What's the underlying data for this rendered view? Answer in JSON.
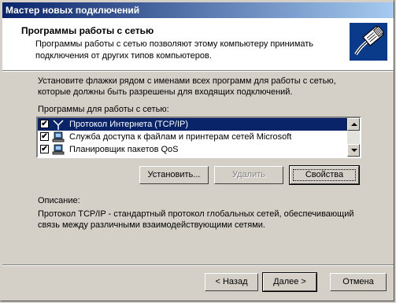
{
  "window": {
    "title": "Мастер новых подключений"
  },
  "header": {
    "title": "Программы работы с сетью",
    "description": "Программы работы с сетью позволяют этому компьютеру принимать подключения от других типов компьютеров.",
    "icon": "network-cable-icon"
  },
  "body": {
    "instruction": "Установите флажки рядом с именами всех программ для работы с сетью, которые должны быть разрешены для входящих подключений.",
    "list_label": "Программы для работы с сетью:",
    "items": [
      {
        "label": "Протокол Интернета (TCP/IP)",
        "checked": true,
        "selected": true,
        "icon": "protocol-icon"
      },
      {
        "label": "Служба доступа к файлам и принтерам сетей Microsoft",
        "checked": true,
        "selected": false,
        "icon": "network-service-icon"
      },
      {
        "label": "Планировщик пакетов QoS",
        "checked": true,
        "selected": false,
        "icon": "network-service-icon"
      }
    ],
    "buttons": {
      "install": "Установить...",
      "remove": "Удалить",
      "properties": "Свойства"
    },
    "description_label": "Описание:",
    "description_text": "Протокол TCP/IP - стандартный протокол глобальных сетей, обеспечивающий связь между различными взаимодействующими сетями."
  },
  "footer": {
    "back": "< Назад",
    "next": "Далее >",
    "cancel": "Отмена"
  },
  "colors": {
    "selection": "#0a246a",
    "face": "#d4d0c8"
  }
}
